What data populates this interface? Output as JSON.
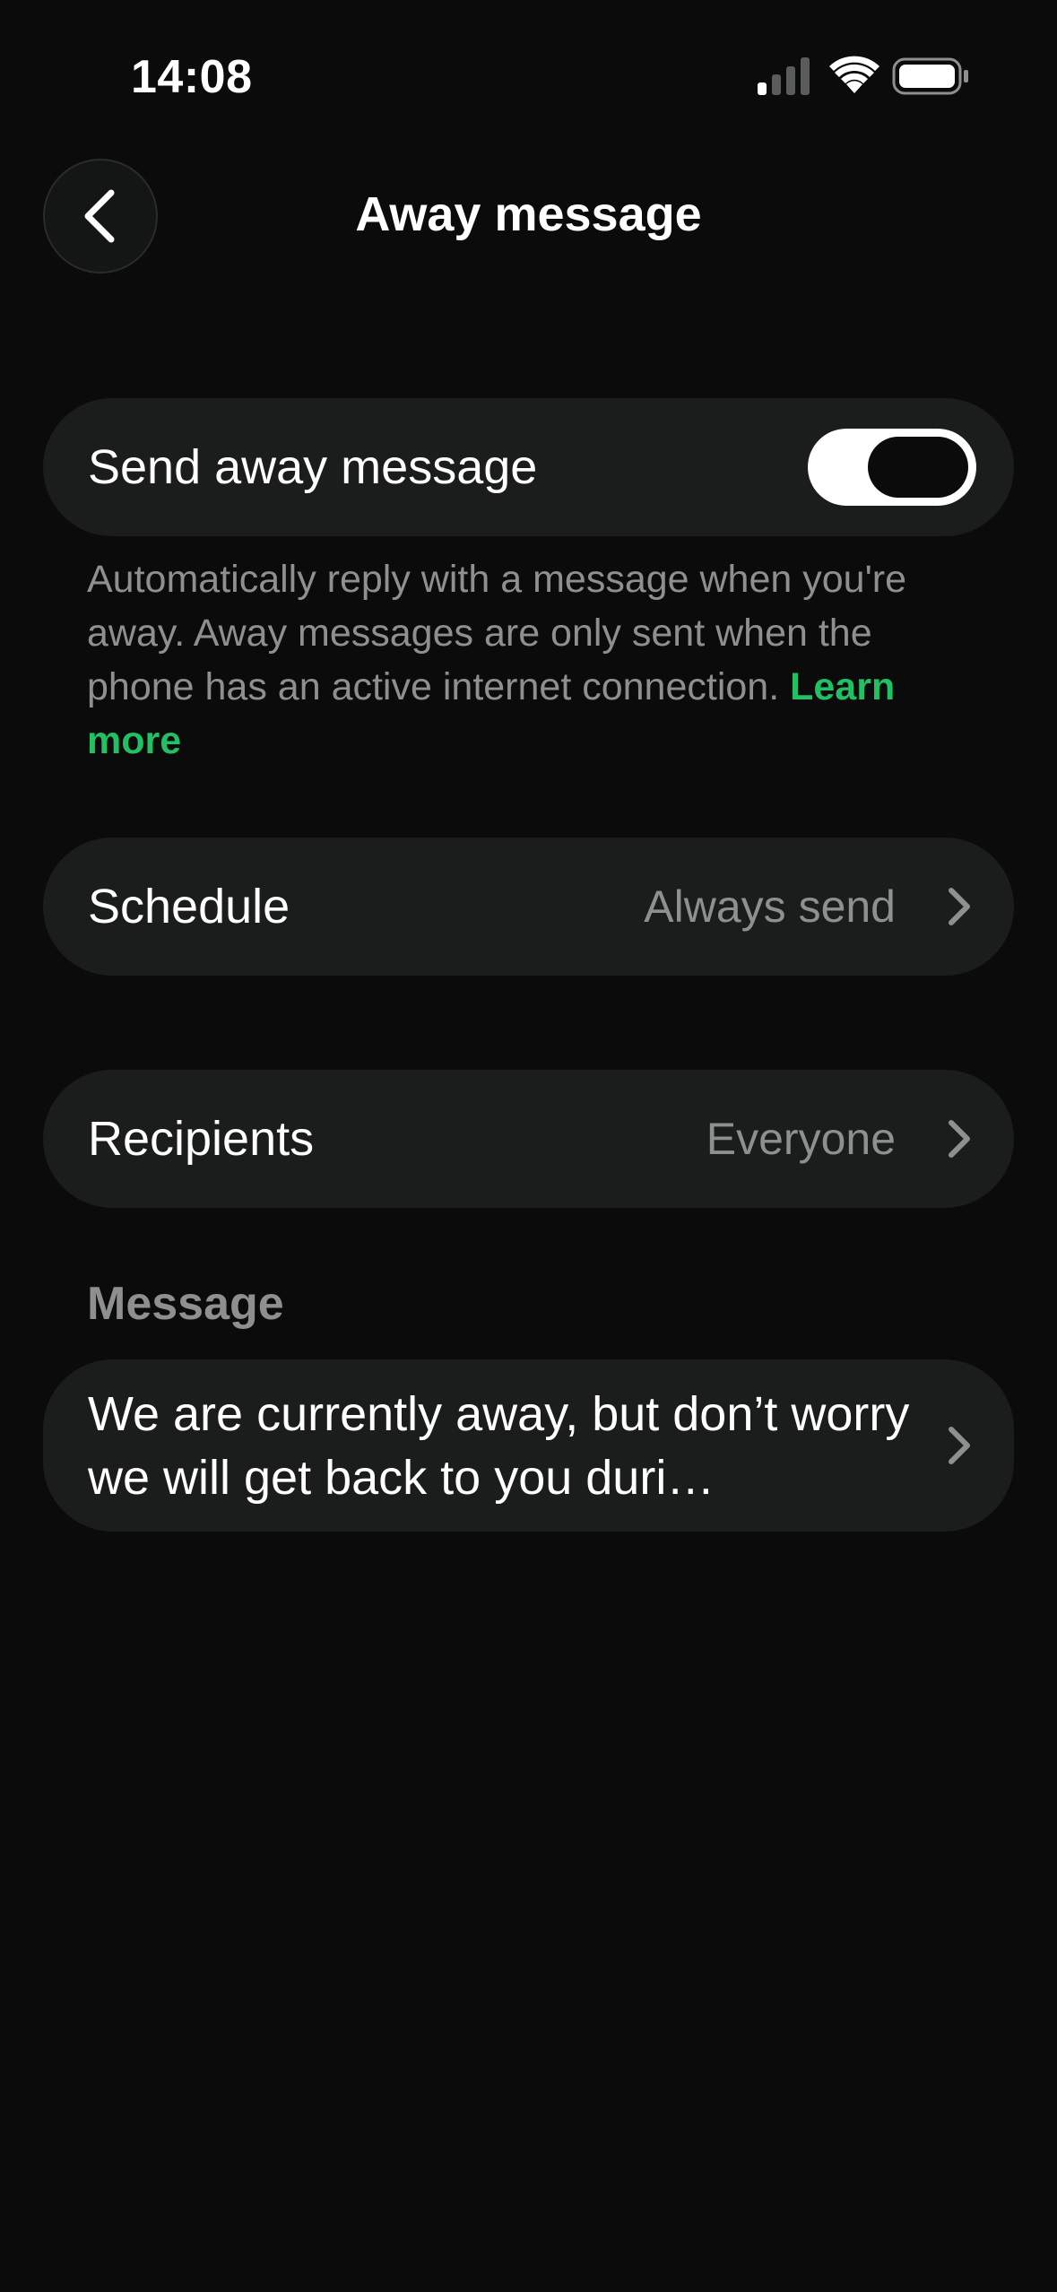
{
  "status_bar": {
    "time": "14:08"
  },
  "header": {
    "title": "Away message",
    "back_icon": "chevron-left-icon"
  },
  "away_toggle": {
    "label": "Send away message",
    "enabled": true
  },
  "description": {
    "text": "Automatically reply with a message when you're away. Away messages are only sent when the phone has an active internet connection.",
    "link": "Learn more"
  },
  "schedule": {
    "label": "Schedule",
    "value": "Always send"
  },
  "recipients": {
    "label": "Recipients",
    "value": "Everyone"
  },
  "message_section": {
    "label": "Message",
    "text": "We are currently away, but don’t worry we will get back to you duri…"
  },
  "colors": {
    "background": "#0b0b0b",
    "card": "#1b1c1c",
    "accent": "#21c063",
    "secondary_text": "#8e8f8f"
  }
}
